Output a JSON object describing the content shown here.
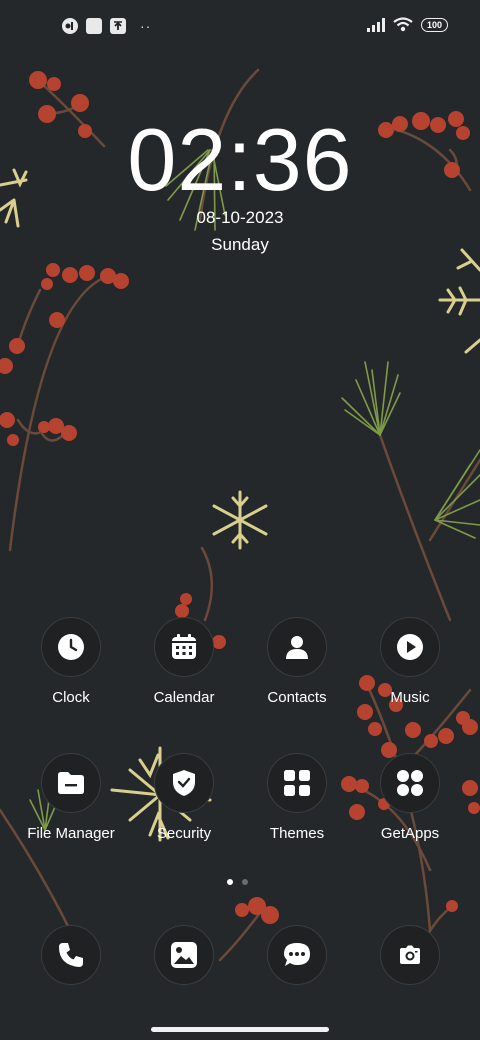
{
  "status_bar": {
    "left_icons": [
      "app-notification-icon",
      "square-notification-icon",
      "upload-notification-icon"
    ],
    "more_dots": "··",
    "right_icons": [
      "signal-icon",
      "wifi-icon",
      "battery-icon"
    ],
    "battery_level": "100"
  },
  "lockclock": {
    "time": "02:36",
    "date": "08-10-2023",
    "day": "Sunday"
  },
  "apps_row1": [
    {
      "label": "Clock",
      "icon": "clock-icon"
    },
    {
      "label": "Calendar",
      "icon": "calendar-icon"
    },
    {
      "label": "Contacts",
      "icon": "contacts-icon"
    },
    {
      "label": "Music",
      "icon": "music-icon"
    }
  ],
  "apps_row2": [
    {
      "label": "File Manager",
      "icon": "folder-icon"
    },
    {
      "label": "Security",
      "icon": "shield-icon"
    },
    {
      "label": "Themes",
      "icon": "themes-grid-icon"
    },
    {
      "label": "GetApps",
      "icon": "getapps-icon"
    }
  ],
  "dock": [
    {
      "icon": "phone-icon"
    },
    {
      "icon": "gallery-icon"
    },
    {
      "icon": "messaging-icon"
    },
    {
      "icon": "camera-icon"
    }
  ],
  "pager": {
    "pages": 2,
    "active": 0
  },
  "colors": {
    "background": "#25282a",
    "berry": "#b5432f",
    "branch": "#6a4a3a",
    "pine": "#7e9a4a",
    "snowflake": "#d9cf8e"
  }
}
